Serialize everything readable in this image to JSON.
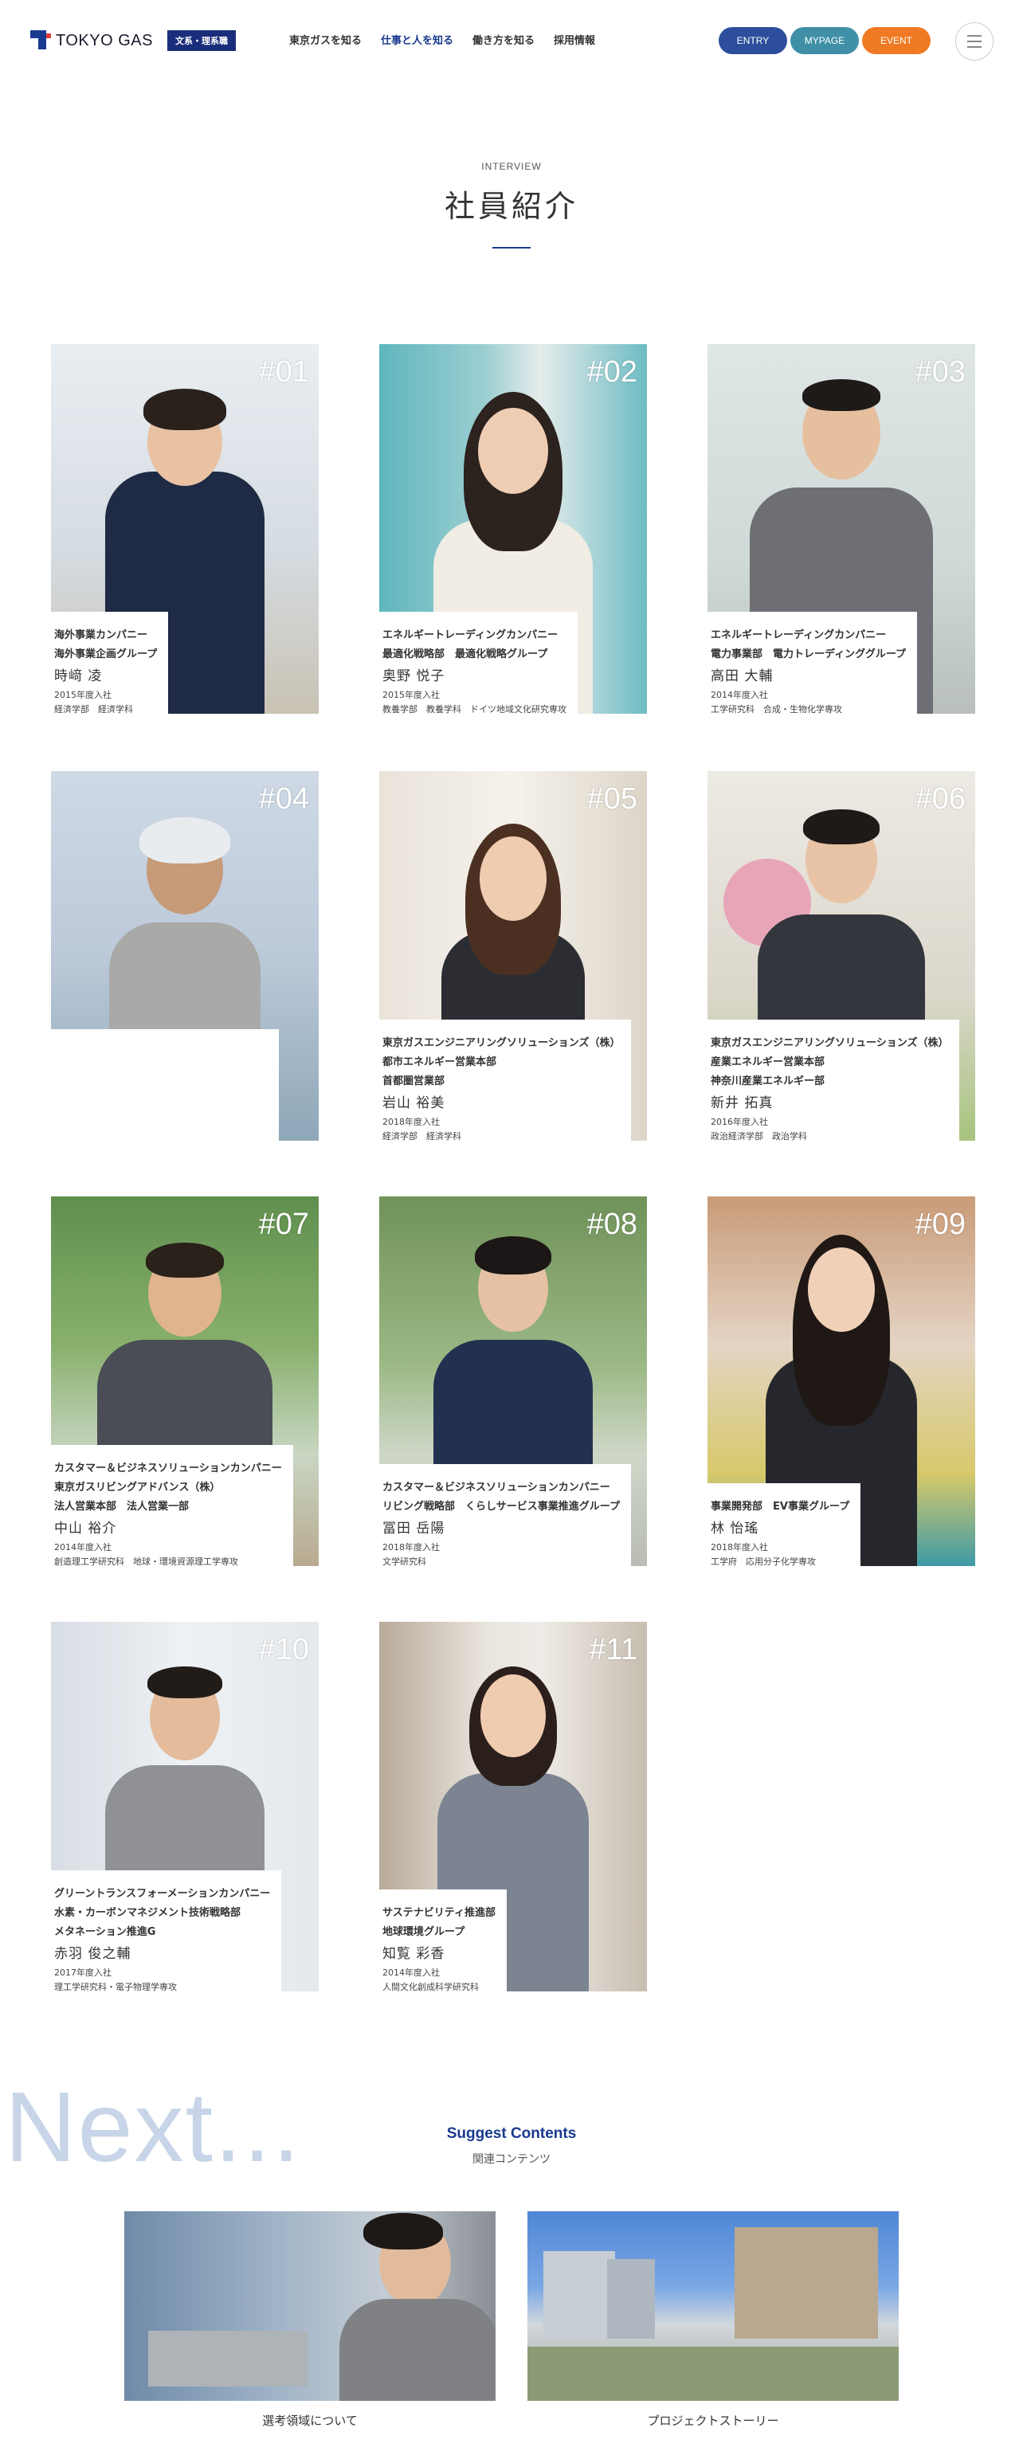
{
  "header": {
    "logo_text": "TOKYO GAS",
    "badge": "文系・理系職",
    "nav": [
      {
        "label": "東京ガスを知る",
        "active": false
      },
      {
        "label": "仕事と人を知る",
        "active": true
      },
      {
        "label": "働き方を知る",
        "active": false
      },
      {
        "label": "採用情報",
        "active": false
      }
    ],
    "cta": {
      "entry": "ENTRY",
      "mypage": "MYPAGE",
      "event": "EVENT"
    }
  },
  "heading": {
    "eyebrow": "INTERVIEW",
    "title": "社員紹介"
  },
  "employees": [
    {
      "num": "#01",
      "dept": [
        "海外事業カンパニー",
        "海外事業企画グループ"
      ],
      "name": "時﨑 凌",
      "year": "2015年度入社",
      "school": "経済学部　経済学科"
    },
    {
      "num": "#02",
      "dept": [
        "エネルギートレーディングカンパニー",
        "最適化戦略部　最適化戦略グループ"
      ],
      "name": "奥野 悦子",
      "year": "2015年度入社",
      "school": "教養学部　教養学科　ドイツ地域文化研究専攻"
    },
    {
      "num": "#03",
      "dept": [
        "エネルギートレーディングカンパニー",
        "電力事業部　電力トレーディンググループ"
      ],
      "name": "高田 大輔",
      "year": "2014年度入社",
      "school": "工学研究科　合成・生物化学専攻"
    },
    {
      "num": "#04",
      "dept": [],
      "name": "",
      "year": "",
      "school": ""
    },
    {
      "num": "#05",
      "dept": [
        "東京ガスエンジニアリングソリューションズ（株）",
        "都市エネルギー営業本部",
        "首都圏営業部"
      ],
      "name": "岩山 裕美",
      "year": "2018年度入社",
      "school": "経済学部　経済学科"
    },
    {
      "num": "#06",
      "dept": [
        "東京ガスエンジニアリングソリューションズ（株）",
        "産業エネルギー営業本部",
        "神奈川産業エネルギー部"
      ],
      "name": "新井 拓真",
      "year": "2016年度入社",
      "school": "政治経済学部　政治学科"
    },
    {
      "num": "#07",
      "dept": [
        "カスタマー＆ビジネスソリューションカンパニー",
        "東京ガスリビングアドバンス（株）",
        "法人営業本部　法人営業一部"
      ],
      "name": "中山 裕介",
      "year": "2014年度入社",
      "school": "創造理工学研究科　地球・環境資源理工学専攻"
    },
    {
      "num": "#08",
      "dept": [
        "カスタマー＆ビジネスソリューションカンパニー",
        "リビング戦略部　くらしサービス事業推進グループ"
      ],
      "name": "冨田 岳陽",
      "year": "2018年度入社",
      "school": "文学研究科"
    },
    {
      "num": "#09",
      "dept": [
        "事業開発部　EV事業グループ"
      ],
      "name": "林 怡瑤",
      "year": "2018年度入社",
      "school": "工学府　応用分子化学専攻"
    },
    {
      "num": "#10",
      "dept": [
        "グリーントランスフォーメーションカンパニー",
        "水素・カーボンマネジメント技術戦略部",
        "メタネーション推進G"
      ],
      "name": "赤羽 俊之輔",
      "year": "2017年度入社",
      "school": "理工学研究科・電子物理学専攻"
    },
    {
      "num": "#11",
      "dept": [
        "サステナビリティ推進部",
        "地球環境グループ"
      ],
      "name": "知覧 彩香",
      "year": "2014年度入社",
      "school": "人間文化創成科学研究科"
    }
  ],
  "next": {
    "big_word": "Next...",
    "title": "Suggest Contents",
    "subtitle": "関連コンテンツ",
    "items": [
      {
        "label": "選考領域について"
      },
      {
        "label": "プロジェクトストーリー"
      }
    ]
  },
  "colors": {
    "brand": "#1a3a8f",
    "entry": "#2d4e9c",
    "mypage": "#3f8fa7",
    "event": "#f07a24"
  }
}
